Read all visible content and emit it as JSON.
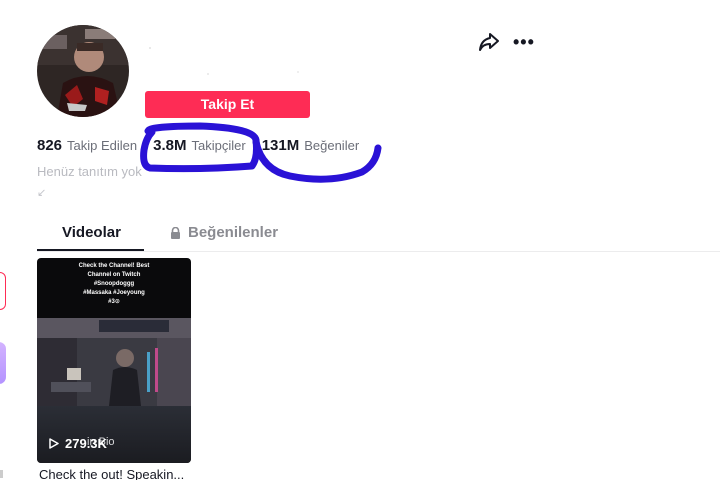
{
  "profile": {
    "avatar": "avatar",
    "follow_label": "Takip Et",
    "bio": "Henüz tanıtım yok",
    "bio_link": "↙"
  },
  "actions": {
    "share_icon": "share-icon",
    "more_icon": "more-icon",
    "more_glyph": "•••"
  },
  "stats": [
    {
      "value": "826",
      "label": "Takip Edilen"
    },
    {
      "value": "3.8M",
      "label": "Takipçiler"
    },
    {
      "value": "131M",
      "label": "Beğeniler"
    }
  ],
  "tabs": [
    {
      "label": "Videolar",
      "active": true
    },
    {
      "label": "Beğenilenler",
      "active": false,
      "icon": "lock-icon"
    }
  ],
  "video": {
    "overlay_lines": [
      "Check the Channel! Best",
      "Channel on Twitch",
      "#Snoopdoggg",
      "#Massaka #Joeyoung",
      "#3⊙"
    ],
    "views": "279.3K",
    "link_in_bio": "in Bio",
    "caption": "Check the out! Speakin..."
  },
  "colors": {
    "accent": "#fe2c55",
    "scribble": "#2a12d6",
    "text": "#161823",
    "muted": "#6b6e78"
  }
}
